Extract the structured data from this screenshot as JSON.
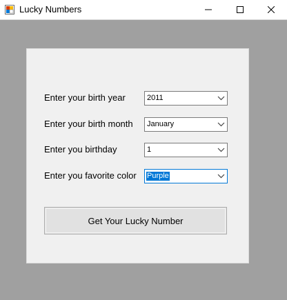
{
  "window": {
    "title": "Lucky Numbers",
    "icon": "winforms-app-icon"
  },
  "controls": {
    "minimize_icon": "minimize-icon",
    "maximize_icon": "maximize-icon",
    "close_icon": "close-icon"
  },
  "form": {
    "birth_year": {
      "label": "Enter your birth year",
      "value": "2011"
    },
    "birth_month": {
      "label": "Enter your birth month",
      "value": "January"
    },
    "birthday": {
      "label": "Enter you birthday",
      "value": "1"
    },
    "favorite_color": {
      "label": "Enter you favorite color",
      "value": "Purple"
    },
    "submit_label": "Get Your Lucky Number"
  },
  "colors": {
    "client_background": "#a0a0a0",
    "panel_background": "#f0f0f0",
    "selection": "#0078d7"
  }
}
